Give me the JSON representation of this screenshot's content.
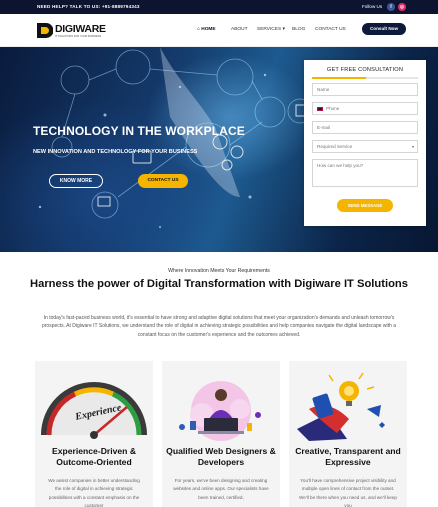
{
  "topbar": {
    "help": "NEED HELP? TALK TO US: +91-8889794343",
    "follow": "Follow Us",
    "social": [
      {
        "icon": "facebook-icon",
        "glyph": "f"
      },
      {
        "icon": "instagram-icon",
        "glyph": "◎"
      }
    ]
  },
  "brand": {
    "name": "DIGIWARE",
    "tagline": "IT SOLUTIONS FOR YOUR BUSINESS"
  },
  "nav": {
    "home": "HOME",
    "about": "ABOUT",
    "services": "SERVICES",
    "blog": "BLOG",
    "contact": "CONTACT US",
    "cta": "Consult Now"
  },
  "hero": {
    "title": "TECHNOLOGY IN THE WORKPLACE",
    "subtitle": "NEW INNOVATION AND TECHNOLOGY FOR YOUR BUSINESS",
    "know_more": "KNOW MORE",
    "contact_us": "CONTACT US"
  },
  "form": {
    "title": "GET FREE CONSULTATION",
    "name_placeholder": "Name",
    "phone_placeholder": "Phone",
    "email_placeholder": "E-mail",
    "service_placeholder": "Required Service",
    "help_placeholder": "How can we help you?",
    "submit": "SEND MESSAGE"
  },
  "intro": {
    "eyebrow": "Where Innovation Meets Your Requirements",
    "headline": "Harness the power of Digital Transformation with Digiware IT Solutions",
    "body": "In today's fast-paced business world, it's essential to have strong and adaptive digital solutions that meet your organization's demands and unleash tomorrow's prospects. At Digiware IT Solutions, we understand the role of digital in achieving strategic possibilities and help companies navigate the digital landscape with a constant focus on the customer's experience and the outcomes achieved."
  },
  "cards": [
    {
      "title": "Experience-Driven & Outcome-Oriented",
      "body": "We assist companies in better understanding the role of digital in achieving strategic possibilities with a constant emphasis on the customer",
      "image_label": "Experience"
    },
    {
      "title": "Qualified Web Designers & Developers",
      "body": "For years, we've been designing and creating websites and online apps. Our specialists have been trained, certified,",
      "image_label": ""
    },
    {
      "title": "Creative, Transparent and Expressive",
      "body": "You'll have comprehensive project visibility and multiple open lines of contact from the outset. We'll be there when you need us, and we'll keep you",
      "image_label": ""
    }
  ],
  "colors": {
    "navy": "#0d1430",
    "accent": "#f5b400"
  }
}
